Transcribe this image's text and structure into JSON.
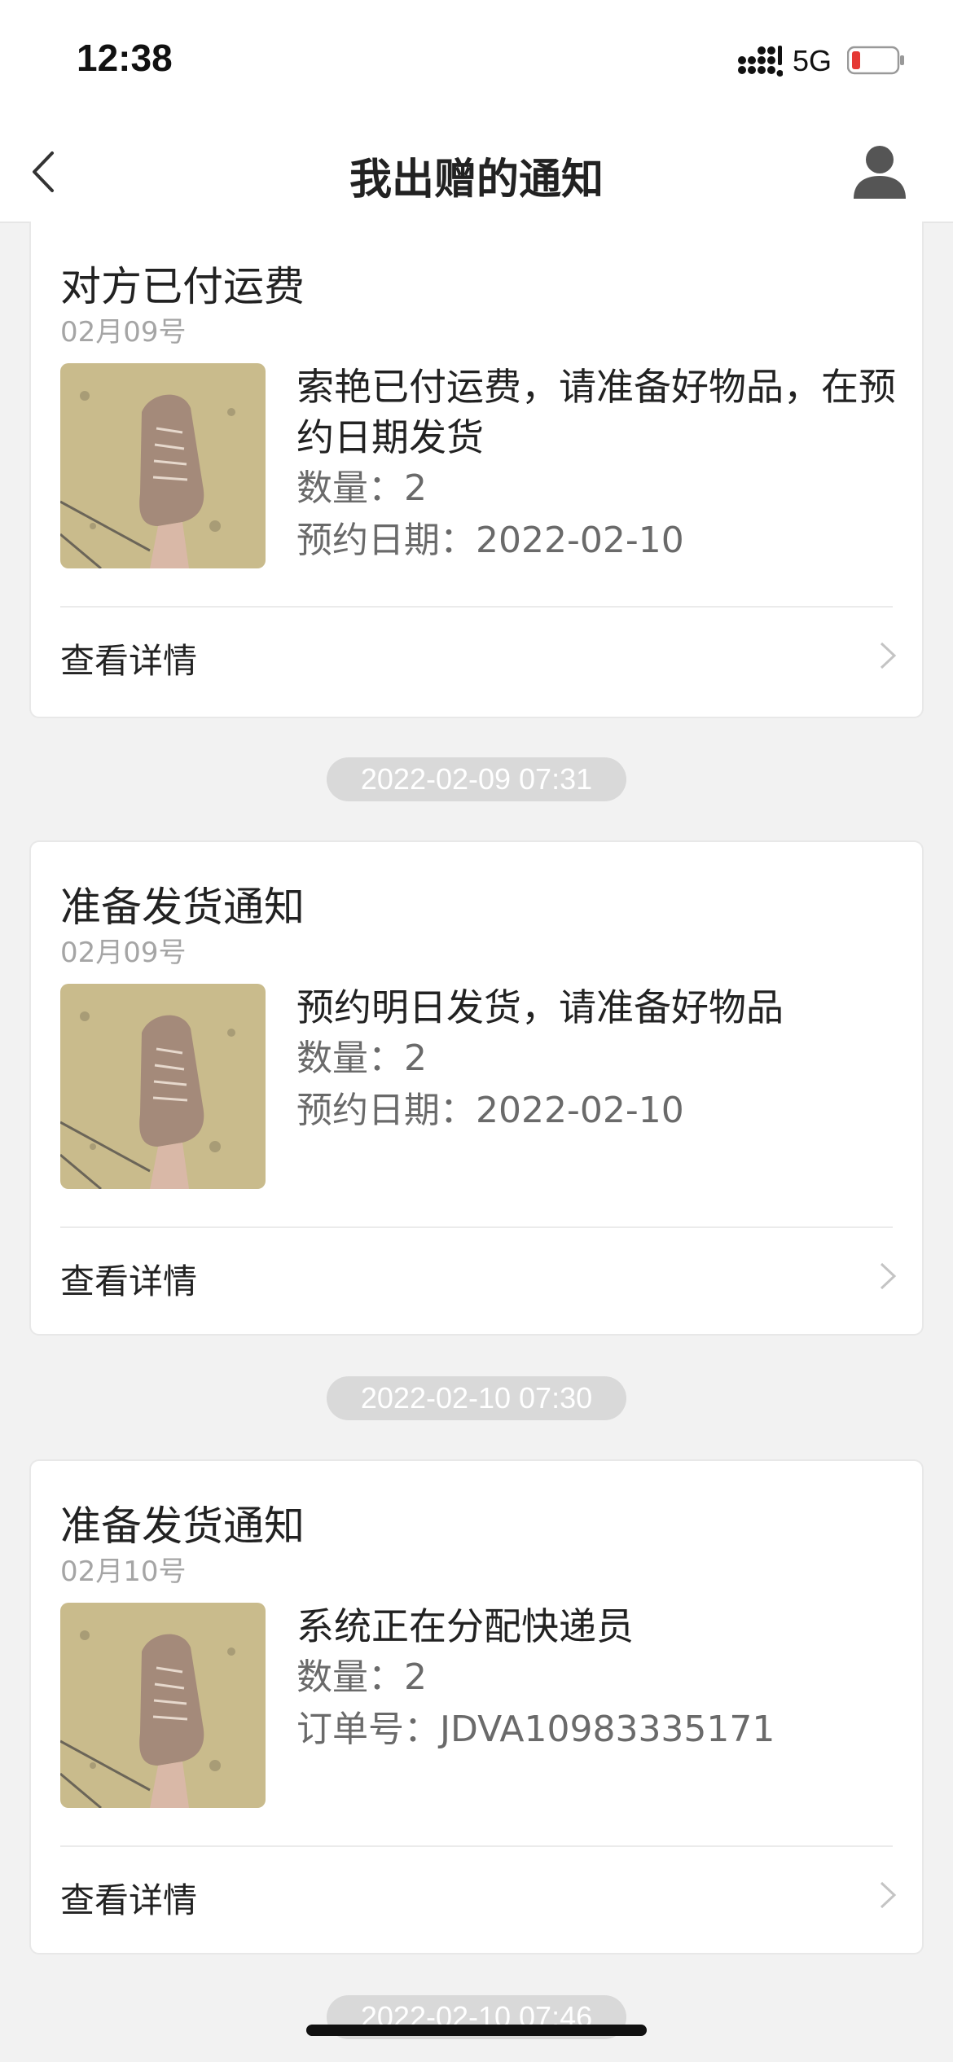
{
  "status_bar": {
    "time": "12:38",
    "network": "5G"
  },
  "nav": {
    "title": "我出赠的通知"
  },
  "notifications": [
    {
      "title": "对方已付运费",
      "date": "02月09号",
      "message": "索艳已付运费，请准备好物品，在预约日期发货",
      "line1": "数量：2",
      "line2": "预约日期：2022-02-10",
      "detail_label": "查看详情"
    },
    {
      "title": "准备发货通知",
      "date": "02月09号",
      "message": "预约明日发货，请准备好物品",
      "line1": "数量：2",
      "line2": "预约日期：2022-02-10",
      "detail_label": "查看详情"
    },
    {
      "title": "准备发货通知",
      "date": "02月10号",
      "message": "系统正在分配快递员",
      "line1": "数量：2",
      "line2": "订单号：JDVA10983335171",
      "detail_label": "查看详情"
    }
  ],
  "timestamps": [
    "2022-02-09 07:31",
    "2022-02-10 07:30",
    "2022-02-10 07:46"
  ]
}
